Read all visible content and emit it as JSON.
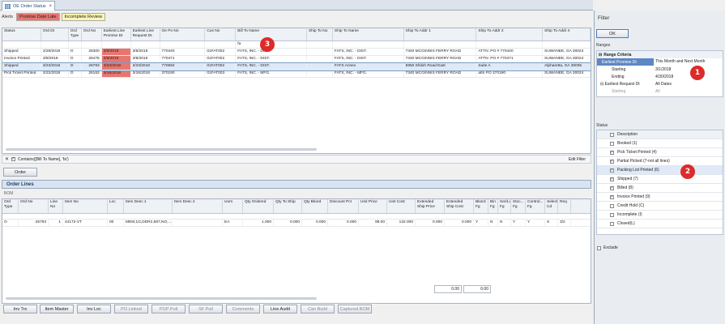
{
  "tab": {
    "label": "OE Order Status",
    "close": "×"
  },
  "alerts": {
    "label": "Alerts",
    "chips": [
      {
        "label": "Promise Date Late",
        "color": "#e8766f"
      },
      {
        "label": "Incomplete Review",
        "color": "#fbf6b3"
      }
    ]
  },
  "orders": {
    "columns": [
      "Status",
      "Ord Dt",
      "Ord Type",
      "Ord No",
      "Earliest Line Promise Dt",
      "Earliest Line Request Dt",
      "Oe Po No",
      "Cus No",
      "Bill To Name",
      "Ship To No",
      "Ship To Name",
      "Ship To Addr 1",
      "Ship To Addr 2",
      "Ship To Addr 4"
    ],
    "filter_value": "fa",
    "rows": [
      [
        "Shipped",
        "2/28/2018",
        "O",
        "26300",
        "3/6/2018",
        "3/6/2018",
        "770440",
        "01FAT002",
        "FATS, INC. - DIST.",
        "",
        "FATS, INC. - DIST.",
        "7340 MCGINNIS FERRY ROAD",
        "ATTN: PO # 770440",
        "SUWANEE, GA 30024"
      ],
      [
        "Invoice Printed",
        "3/8/2018",
        "O",
        "26476",
        "3/8/2018",
        "3/8/2018",
        "770471",
        "01FAT002",
        "FATS, INC. - DIST.",
        "",
        "FATS, INC. - DIST.",
        "7340 MCGINNIS FERRY ROAD",
        "ATTN: PO # 770471",
        "SUWANEE, GA 30024"
      ],
      [
        "Shipped",
        "3/23/2018",
        "O",
        "26793",
        "3/23/2018",
        "3/23/2018",
        "770592",
        "01FAT002",
        "FATS, INC. - DIST.",
        "",
        "FATS Annex",
        "5950 Shiloh Road East",
        "Suite A",
        "Alpharetta, GA 30005"
      ],
      [
        "Pick Ticket Printed",
        "2/22/2018",
        "O",
        "26183",
        "3/16/2018",
        "3/16/2018",
        "370190",
        "01FAT003",
        "FATS, INC. - MFG.",
        "",
        "FATS, INC. - MFG.",
        "7340 MCGINNIS FERRY ROAD",
        "attn PO 370190",
        "SUWANEE, GA 30024"
      ]
    ],
    "filter_text": "Contains([Bill To Name], 'fa')",
    "edit_filter": "Edit Filter",
    "order_button": "Order"
  },
  "lines": {
    "title": "Order Lines",
    "bom": "BOM",
    "columns": [
      "Ord Type",
      "Ord No",
      "Line No",
      "Item No",
      "Loc",
      "Item Desc 1",
      "Item Desc 2",
      "Uom",
      "Qty Ordered",
      "Qty To Ship",
      "Qty Bkord",
      "Discount Pct",
      "Unit Price",
      "Unit Cost",
      "Extended Ship Price",
      "Extended Ship Cost",
      "Bkord Fg",
      "Bin Fg",
      "Ser/Lot Fg",
      "Stoc... Fg",
      "Control... Fg",
      "Select Cd",
      "Req"
    ],
    "rows": [
      [
        "O",
        "26793",
        "1",
        "44172-VT",
        "00",
        "MEM,1G,DDR2,667,NO,...",
        "",
        "EA",
        "1.000",
        "0.000",
        "0.000",
        "0.000",
        "98.00",
        "132.000",
        "0.000",
        "0.000",
        "Y",
        "N",
        "N",
        "Y",
        "Y",
        "S",
        "3/2"
      ]
    ],
    "total1": "0.00",
    "total2": "0.00"
  },
  "bottom_buttons": [
    {
      "label": "Inv Trx",
      "enabled": true
    },
    {
      "label": "Item Master",
      "enabled": true
    },
    {
      "label": "Inv Loc",
      "enabled": true
    },
    {
      "label": "PO Linked",
      "enabled": false
    },
    {
      "label": "POP Pull",
      "enabled": false
    },
    {
      "label": "SF Pull",
      "enabled": false
    },
    {
      "label": "Comments",
      "enabled": false
    },
    {
      "label": "Line Audit",
      "enabled": true
    },
    {
      "label": "Can Build",
      "enabled": false
    },
    {
      "label": "Captured BOM",
      "enabled": false
    }
  ],
  "filter": {
    "title": "Filter",
    "ok": "OK",
    "ranges_label": "Ranges",
    "range_criteria": "Range Criteria",
    "promise": {
      "label": "Earliest Promise Dt",
      "value": "This Month and Next Month",
      "starting_label": "Starting",
      "starting": "3/1/2018",
      "ending_label": "Ending",
      "ending": "4/30/2018"
    },
    "request": {
      "label": "Earliest Request Dt",
      "value": "All Dates",
      "starting_label": "Starting",
      "starting": "All",
      "ending_label": "Ending",
      "ending": "All"
    },
    "status_label": "Status",
    "description_header": "Description",
    "statuses": [
      {
        "label": "Booked (1)",
        "checked": false
      },
      {
        "label": "Pick Ticket Printed (4)",
        "checked": true
      },
      {
        "label": "Partial Picked (7-not all lines)",
        "checked": true
      },
      {
        "label": "Packing List Printed (6)",
        "checked": true
      },
      {
        "label": "Shipped (7)",
        "checked": true
      },
      {
        "label": "Billed (8)",
        "checked": true
      },
      {
        "label": "Invoice Printed (9)",
        "checked": true
      },
      {
        "label": "Credit Hold (C)",
        "checked": false
      },
      {
        "label": "Incomplete (I)",
        "checked": false
      },
      {
        "label": "Closed(L)",
        "checked": false
      }
    ],
    "exclude": "Exclude"
  },
  "callouts": [
    "1",
    "2",
    "3"
  ]
}
